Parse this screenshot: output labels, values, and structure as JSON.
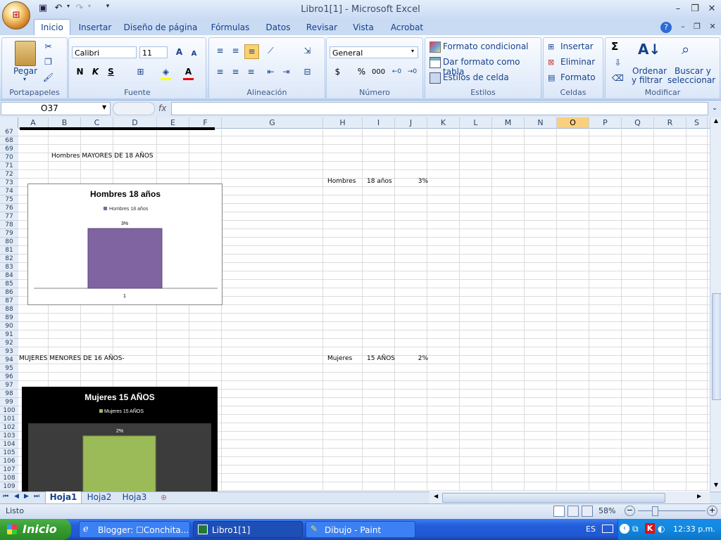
{
  "window": {
    "title": "Libro1[1] - Microsoft Excel",
    "office_logo": "office-logo"
  },
  "qat": {
    "save_icon": "save-icon",
    "undo_icon": "undo-icon",
    "redo_icon": "redo-icon",
    "customize_icon": "customize-qat-icon"
  },
  "tabs": [
    "Inicio",
    "Insertar",
    "Diseño de página",
    "Fórmulas",
    "Datos",
    "Revisar",
    "Vista",
    "Acrobat"
  ],
  "ribbon": {
    "clipboard": {
      "label": "Portapapeles",
      "paste": "Pegar"
    },
    "font": {
      "label": "Fuente",
      "font_name": "Calibri",
      "font_size": "11",
      "bold": "N",
      "italic": "K",
      "underline": "S"
    },
    "alignment": {
      "label": "Alineación"
    },
    "number": {
      "label": "Número",
      "format": "General",
      "currency": "$",
      "percent": "%",
      "thousands": "000"
    },
    "styles": {
      "label": "Estilos",
      "conditional": "Formato condicional",
      "as_table": "Dar formato como tabla",
      "cell_styles": "Estilos de celda"
    },
    "cells": {
      "label": "Celdas",
      "insert": "Insertar",
      "delete": "Eliminar",
      "format": "Formato"
    },
    "editing": {
      "label": "Modificar",
      "sort1": "Ordenar",
      "sort2": "y filtrar",
      "find1": "Buscar y",
      "find2": "seleccionar",
      "sum": "Σ"
    }
  },
  "formula_bar": {
    "name_box": "O37",
    "fx": "fx",
    "value": ""
  },
  "columns": [
    "A",
    "B",
    "C",
    "D",
    "E",
    "F",
    "G",
    "H",
    "I",
    "J",
    "K",
    "L",
    "M",
    "N",
    "O",
    "P",
    "Q",
    "R",
    "S"
  ],
  "selected_column": "O",
  "rows": [
    "67",
    "68",
    "69",
    "70",
    "71",
    "72",
    "73",
    "74",
    "75",
    "76",
    "77",
    "78",
    "79",
    "80",
    "81",
    "82",
    "83",
    "84",
    "85",
    "86",
    "87",
    "88",
    "89",
    "90",
    "91",
    "92",
    "93",
    "94",
    "95",
    "96",
    "97",
    "98",
    "99",
    "100",
    "101",
    "102",
    "103",
    "104",
    "105",
    "106",
    "107",
    "108",
    "109"
  ],
  "cells": {
    "r70": "Hombres MAYORES DE 18 AÑOS",
    "r73_h": "Hombres",
    "r73_i": "18 años",
    "r73_j": "3%",
    "r94": "MUJERES MENORES  DE 16 AÑOS-",
    "r94_h": "Mujeres",
    "r94_i": "15 AÑOS",
    "r94_j": "2%"
  },
  "chart_data": [
    {
      "type": "bar",
      "title": "Hombres 18 años",
      "categories": [
        "1"
      ],
      "series": [
        {
          "name": "Hombres 18 años",
          "values": [
            3
          ]
        }
      ],
      "data_labels": [
        "3%"
      ],
      "color": "#8064a2",
      "background": "#ffffff"
    },
    {
      "type": "bar",
      "title": "Mujeres 15 AÑOS",
      "categories": [],
      "series": [
        {
          "name": "Mujeres 15 AÑOS",
          "values": [
            2
          ]
        }
      ],
      "data_labels": [
        "2%"
      ],
      "color": "#9bbb59",
      "background": "#000000"
    }
  ],
  "sheets": [
    "Hoja1",
    "Hoja2",
    "Hoja3"
  ],
  "active_sheet": "Hoja1",
  "status": {
    "ready": "Listo",
    "zoom": "58%"
  },
  "taskbar": {
    "start": "Inicio",
    "tasks": [
      "Blogger: ☐Conchita...",
      "Libro1[1]",
      "Dibujo - Paint"
    ],
    "lang": "ES",
    "clock": "12:33 p.m."
  },
  "colors": {
    "accent": "#15428b",
    "ribbon": "#d9e7f9",
    "taskbar": "#245edb",
    "start": "#389e33"
  }
}
